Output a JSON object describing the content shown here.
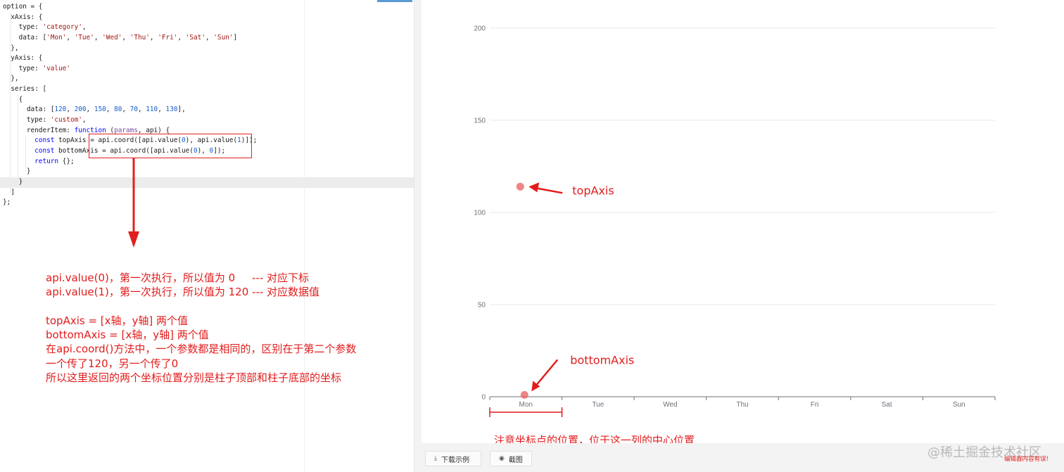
{
  "editor": {
    "code_lines": [
      "option = {",
      "  xAxis: {",
      "    type: 'category',",
      "    data: ['Mon', 'Tue', 'Wed', 'Thu', 'Fri', 'Sat', 'Sun']",
      "  },",
      "  yAxis: {",
      "    type: 'value'",
      "  },",
      "  series: [",
      "    {",
      "      data: [120, 200, 150, 80, 70, 110, 130],",
      "      type: 'custom',",
      "      renderItem: function (params, api) {",
      "        const topAxis = api.coord([api.value(0), api.value(1)]);",
      "        const bottomAxis = api.coord([api.value(0), 0]);",
      "        return {};",
      "      }",
      "    }",
      "  ]",
      "};"
    ],
    "highlighted_line_index": 17
  },
  "notes": [
    "api.value(0)，第一次执行，所以值为 0     --- 对应下标",
    "api.value(1)，第一次执行，所以值为 120 --- 对应数据值",
    "",
    "topAxis = [x轴，y轴] 两个值",
    "bottomAxis = [x轴，y轴] 两个值",
    "在api.coord()方法中，一个参数都是相同的，区别在于第二个参数",
    "一个传了120，另一个传了0",
    "所以这里返回的两个坐标位置分别是柱子顶部和柱子底部的坐标"
  ],
  "chart_data": {
    "type": "scatter",
    "categories": [
      "Mon",
      "Tue",
      "Wed",
      "Thu",
      "Fri",
      "Sat",
      "Sun"
    ],
    "y_ticks": [
      0,
      50,
      100,
      150,
      200
    ],
    "ylim": [
      0,
      200
    ],
    "grid": true,
    "points": [
      {
        "category": "Mon",
        "y": 114,
        "label": "topAxis"
      },
      {
        "category": "Mon",
        "y": 1,
        "label": "bottomAxis"
      }
    ],
    "point_color": "#e85c5c",
    "annotation_color": "#e21c1c",
    "bottom_note": "注意坐标点的位置，位于这一列的中心位置"
  },
  "buttons": {
    "download_label": "下载示例",
    "screenshot_label": "截图"
  },
  "watermark": "@稀土掘金技术社区",
  "error_tag": "编辑器内容有误!"
}
